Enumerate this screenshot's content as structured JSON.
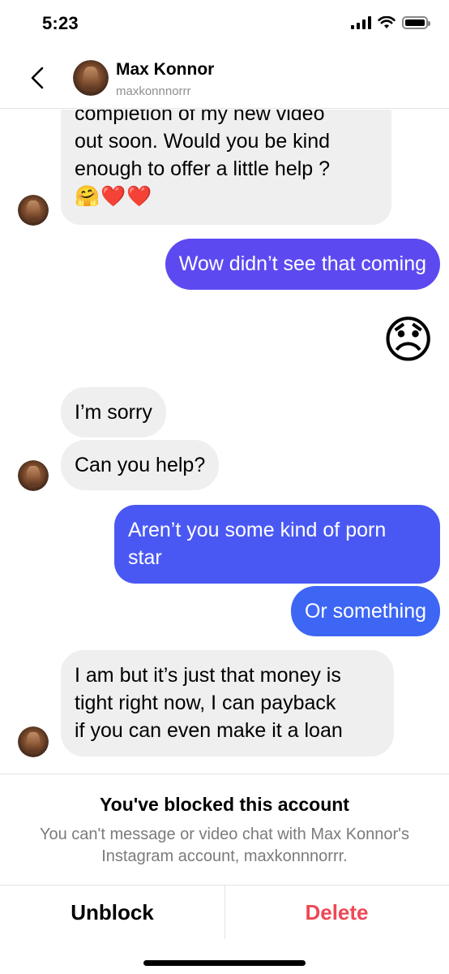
{
  "status_bar": {
    "time": "5:23"
  },
  "header": {
    "name": "Max Konnor",
    "handle": "maxkonnnorrr"
  },
  "messages": [
    {
      "side": "in",
      "lines": [
        "completion of my new video",
        "out soon. Would you be kind",
        "enough to offer a little help ?",
        "🤗❤️❤️"
      ]
    },
    {
      "side": "out",
      "text": "Wow didn’t see that coming"
    },
    {
      "side": "out-emoji",
      "text": "😞"
    },
    {
      "side": "in",
      "text": "I’m sorry"
    },
    {
      "side": "in",
      "text": "Can you help?"
    },
    {
      "side": "out",
      "lines": [
        "Aren’t you some kind of porn",
        "star"
      ]
    },
    {
      "side": "out",
      "text": "Or something"
    },
    {
      "side": "in",
      "lines": [
        "I am but it’s just that money is",
        "tight right now, I can payback",
        "if you can even make it a loan"
      ]
    }
  ],
  "blocked": {
    "title": "You've blocked this account",
    "text": "You can't message or video chat with Max Konnor's Instagram account, maxkonnnorrr."
  },
  "actions": {
    "unblock": "Unblock",
    "delete": "Delete"
  },
  "colors": {
    "bubble_purple": "#5c4af0",
    "bubble_blue": "#3d66f5",
    "incoming": "#efefef",
    "delete_red": "#ed4956"
  }
}
